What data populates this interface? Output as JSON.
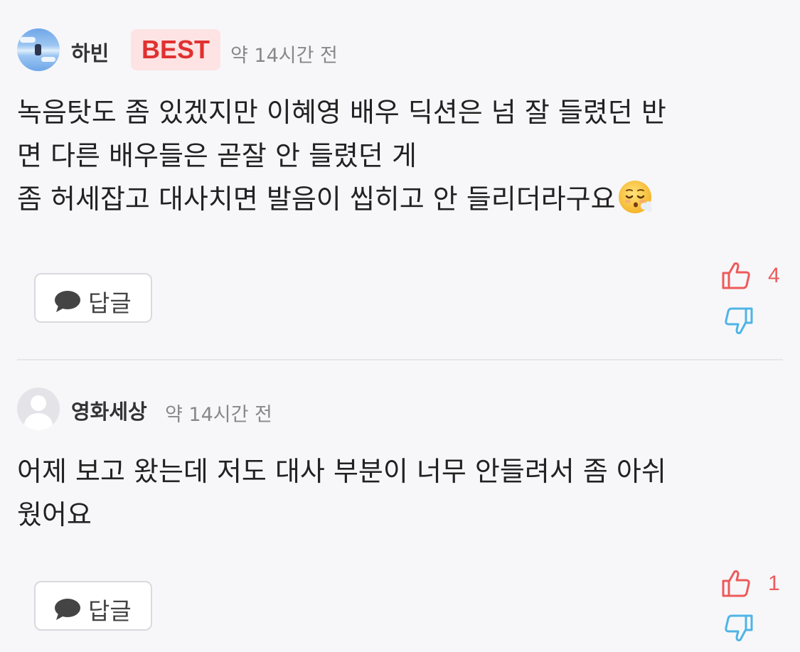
{
  "comments": [
    {
      "author": "하빈",
      "badge": "BEST",
      "time": "약 14시간 전",
      "text": "녹음탓도 좀 있겠지만 이혜영 배우 딕션은 넘 잘 들렸던 반\n면 다른 배우들은 곧잘 안 들렸던 게\n좀 허세잡고 대사치면 발음이 씹히고 안 들리더라구요",
      "emoji": "exhaling-face",
      "reply_label": "답글",
      "likes": "4"
    },
    {
      "author": "영화세상",
      "time": "약 14시간 전",
      "text": "어제 보고 왔는데 저도 대사 부분이 너무 안들려서 좀 아쉬\n웠어요",
      "reply_label": "답글",
      "likes": "1"
    }
  ],
  "colors": {
    "like": "#ee5a5a",
    "dislike": "#4fb4e6",
    "best_bg": "#fde3e3",
    "best_text": "#e03131"
  }
}
